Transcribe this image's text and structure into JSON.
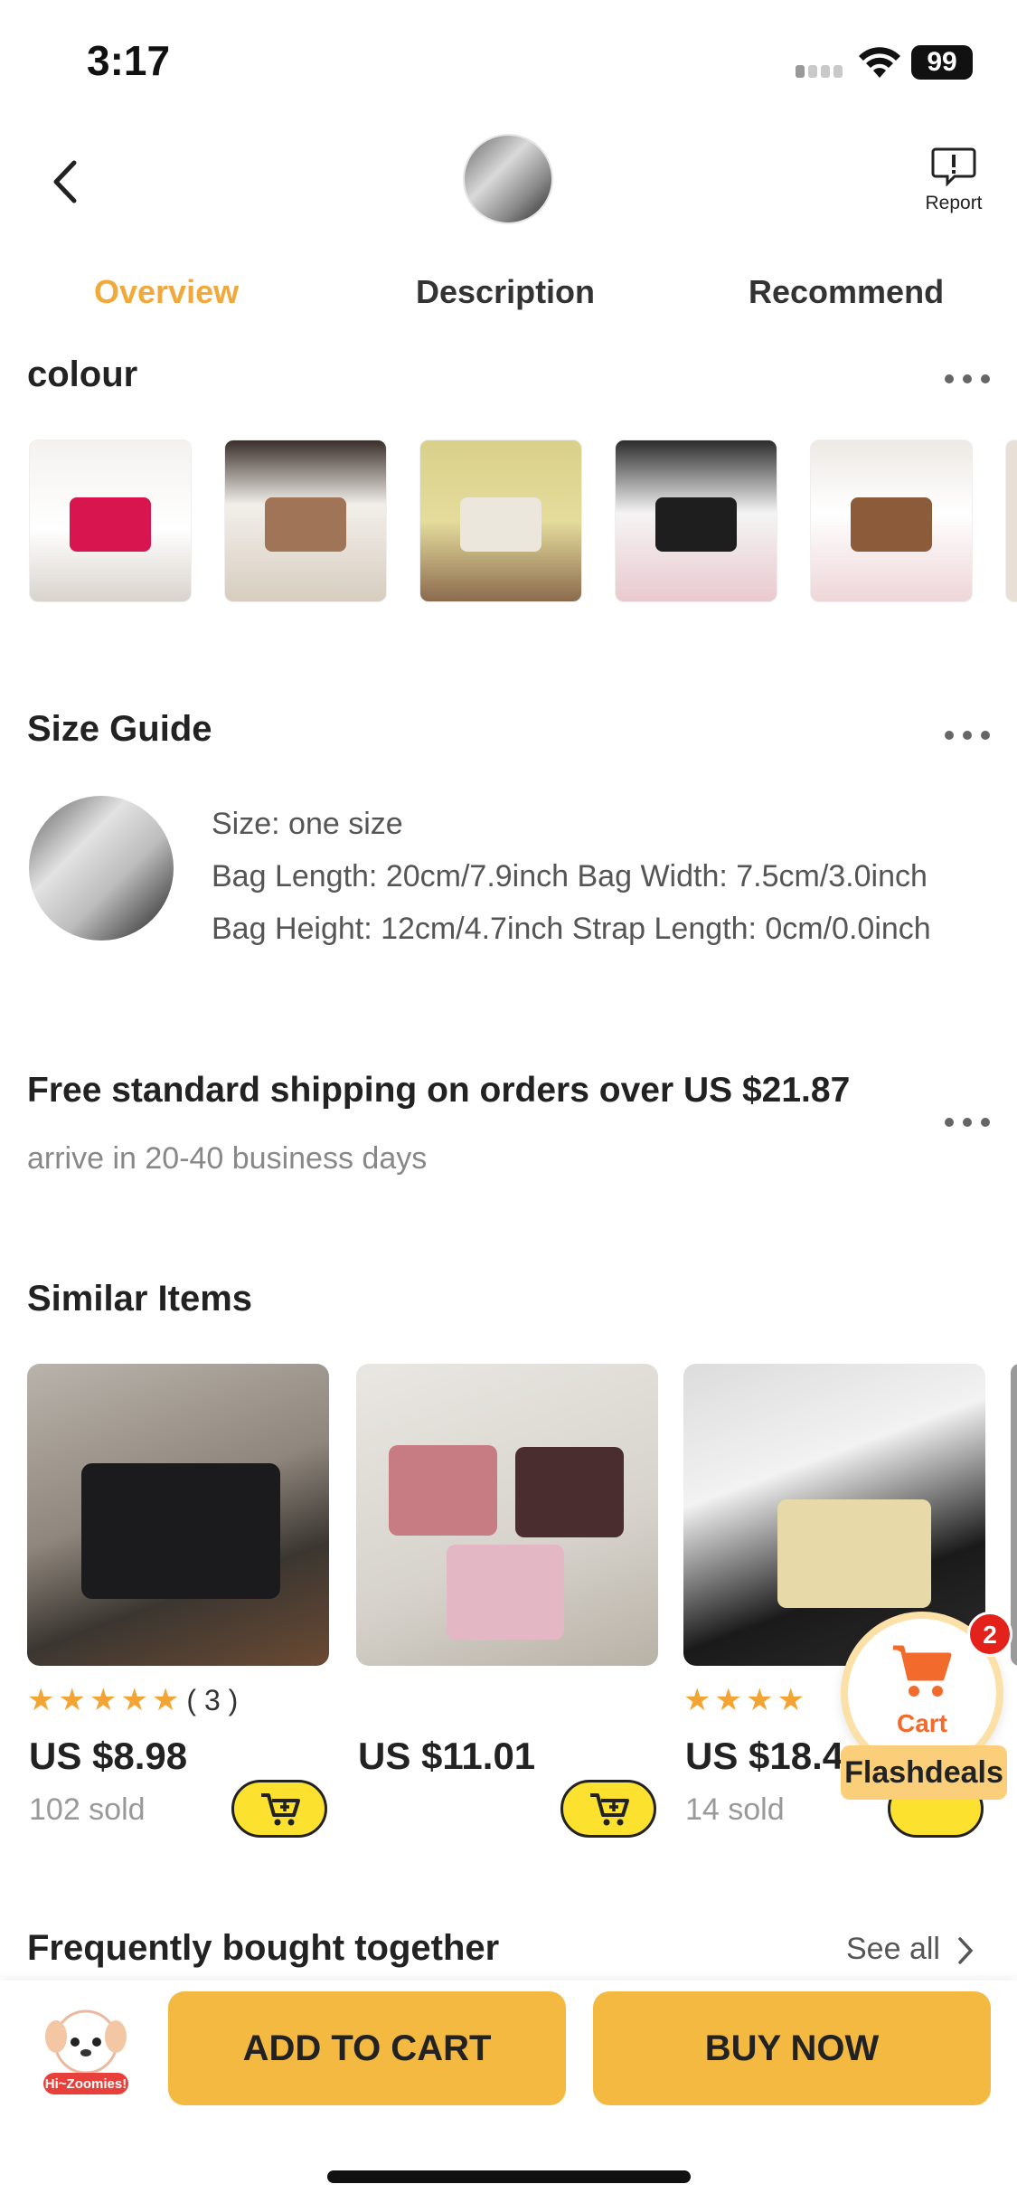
{
  "status_bar": {
    "time": "3:17",
    "battery": "99"
  },
  "header": {
    "report_label": "Report"
  },
  "tabs": [
    {
      "label": "Overview",
      "active": true
    },
    {
      "label": "Description",
      "active": false
    },
    {
      "label": "Recommend",
      "active": false
    }
  ],
  "colour": {
    "title": "colour",
    "swatches": [
      {
        "name": "rose-red",
        "color": "#d8154f"
      },
      {
        "name": "brown",
        "color": "#a07456"
      },
      {
        "name": "white",
        "color": "#ece7dd"
      },
      {
        "name": "black",
        "color": "#1e1e1e"
      },
      {
        "name": "brown-strap",
        "color": "#8b5b3a"
      }
    ]
  },
  "size_guide": {
    "title": "Size Guide",
    "lines": [
      "Size: one size",
      "Bag Length: 20cm/7.9inch Bag Width: 7.5cm/3.0inch",
      "Bag Height: 12cm/4.7inch Strap Length: 0cm/0.0inch"
    ]
  },
  "shipping": {
    "title": "Free standard shipping on orders over US $21.87",
    "subtitle": "arrive in 20-40 business days"
  },
  "similar_items": {
    "title": "Similar Items",
    "products": [
      {
        "price": "US $8.98",
        "stars": "★★★★★",
        "reviews": "( 3 )",
        "sold": "102 sold"
      },
      {
        "price": "US $11.01",
        "stars": "",
        "reviews": "",
        "sold": ""
      },
      {
        "price": "US $18.4",
        "stars": "★★★★",
        "reviews": "",
        "sold": "14 sold"
      }
    ]
  },
  "floating_cart": {
    "label": "Cart",
    "badge": "2",
    "promo": "Flashdeals"
  },
  "frequently_bought": {
    "title": "Frequently bought together",
    "see_all": "See all"
  },
  "bottom_bar": {
    "mascot_label": "Hi~Zoomies!",
    "add_to_cart": "ADD TO CART",
    "buy_now": "BUY NOW"
  },
  "colors": {
    "accent": "#f0a93a",
    "button": "#f4b941",
    "cart_button": "#fde12f",
    "badge": "#e3231b"
  }
}
